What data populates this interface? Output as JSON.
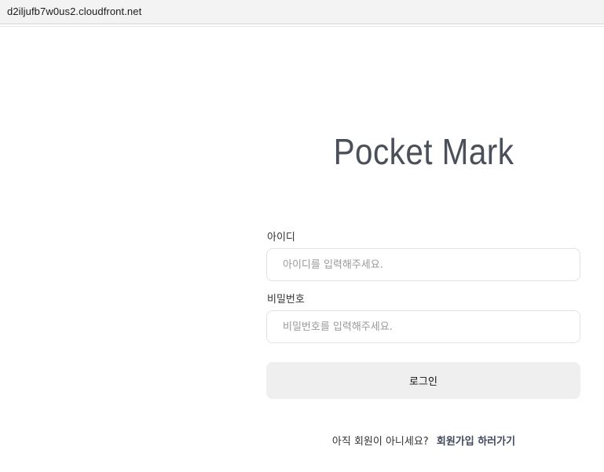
{
  "browser": {
    "url": "d2iljufb7w0us2.cloudfront.net"
  },
  "app": {
    "title": "Pocket Mark"
  },
  "login_form": {
    "id_label": "아이디",
    "id_placeholder": "아이디를 입력해주세요.",
    "password_label": "비밀번호",
    "password_placeholder": "비밀번호를 입력해주세요.",
    "submit_label": "로그인"
  },
  "signup": {
    "question": "아직 회원이 아니세요?",
    "link_label": "회원가입 하러가기"
  }
}
